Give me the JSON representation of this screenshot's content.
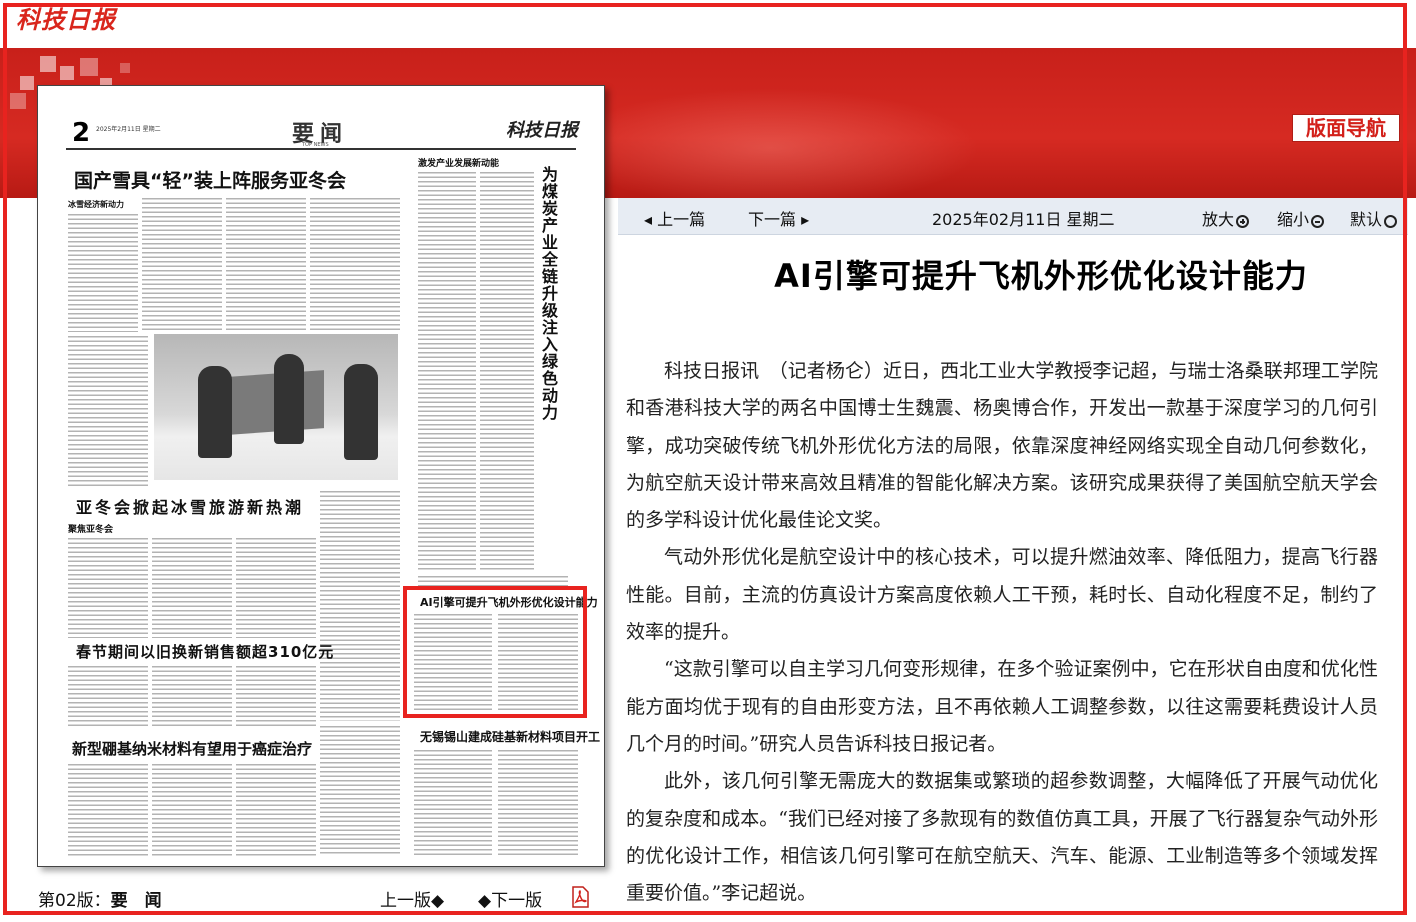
{
  "site": {
    "logo_text": "科技日报"
  },
  "nav": {
    "button_label": "版面导航"
  },
  "toolbar": {
    "prev_article": "上一篇",
    "next_article": "下一篇",
    "date": "2025年02月11日  星期二",
    "zoom_in": "放大",
    "zoom_out": "缩小",
    "default": "默认"
  },
  "article": {
    "title": "AI引擎可提升飞机外形优化设计能力",
    "paragraphs": [
      "科技日报讯　（记者杨仑）近日，西北工业大学教授李记超，与瑞士洛桑联邦理工学院和香港科技大学的两名中国博士生魏震、杨奥博合作，开发出一款基于深度学习的几何引擎，成功突破传统飞机外形优化方法的局限，依靠深度神经网络实现全自动几何参数化，为航空航天设计带来高效且精准的智能化解决方案。该研究成果获得了美国航空航天学会的多学科设计优化最佳论文奖。",
      "气动外形优化是航空设计中的核心技术，可以提升燃油效率、降低阻力，提高飞行器性能。目前，主流的仿真设计方案高度依赖人工干预，耗时长、自动化程度不足，制约了效率的提升。",
      "“这款引擎可以自主学习几何变形规律，在多个验证案例中，它在形状自由度和优化性能方面均优于现有的自由形变方法，且不再依赖人工调整参数，以往这需要耗费设计人员几个月的时间。”研究人员告诉科技日报记者。",
      "此外，该几何引擎无需庞大的数据集或繁琐的超参数调整，大幅降低了开展气动优化的复杂度和成本。“我们已经对接了多款现有的数值仿真工具，开展了飞行器复杂气动外形的优化设计工作，相信该几何引擎可在航空航天、汽车、能源、工业制造等多个领域发挥重要价值。”李记超说。"
    ]
  },
  "paper": {
    "page_number": "2",
    "date_line": "2025年2月11日  星期二",
    "section_title": "要闻",
    "section_sub": "TOP NEWS",
    "logo": "科技日报",
    "headlines": {
      "h1": "国产雪具“轻”装上阵服务亚冬会",
      "h1_tag": "冰雪经济新动力",
      "h2": "亚冬会掀起冰雪旅游新热潮",
      "h2_tag": "聚焦亚冬会",
      "h3": "春节期间以旧换新销售额超310亿元",
      "h4": "新型硼基纳米材料有望用于癌症治疗",
      "h5": "AI引擎可提升飞机外形优化设计能力",
      "h6": "无锡锡山建成硅基新材料项目开工",
      "right_tag": "激发产业发展新动能",
      "vertical": "为煤炭产业全链升级注入绿色动力"
    }
  },
  "footer": {
    "page_label": "第02版：",
    "page_name": "要　闻",
    "prev_page": "上一版",
    "next_page": "下一版"
  }
}
